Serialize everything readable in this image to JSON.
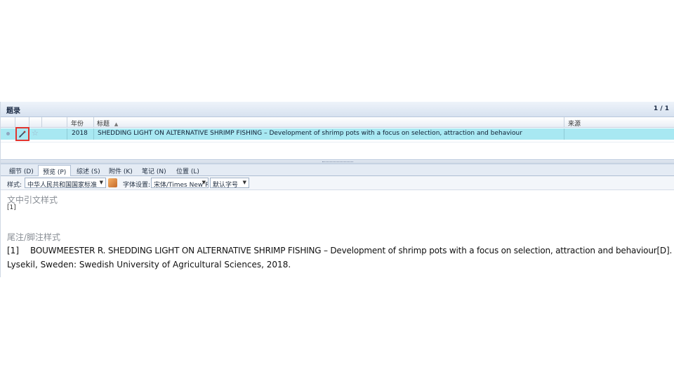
{
  "pane": {
    "title": "题录",
    "pager": "1 / 1"
  },
  "grid": {
    "columns": {
      "year": "年份",
      "title": "标题",
      "sort_indicator": "▲",
      "source": "来源"
    },
    "rows": [
      {
        "year": "2018",
        "title": "SHEDDING LIGHT ON ALTERNATIVE SHRIMP FISHING – Development of shrimp pots with a focus on selection, attraction and behaviour",
        "source": ""
      }
    ]
  },
  "tabs": [
    "细节 (D)",
    "预览 (P)",
    "综述 (S)",
    "附件 (K)",
    "笔记 (N)",
    "位置 (L)"
  ],
  "active_tab_index": 1,
  "toolbar": {
    "style_label": "样式:",
    "style_value": "中华人民共和国国家标准",
    "font_label": "字体设置:",
    "font_value": "宋体/Times New Roman",
    "size_value": "默认字号"
  },
  "preview": {
    "intext_heading": "文中引文样式",
    "intext_citation": "[1]",
    "footnote_heading": "尾注/脚注样式",
    "ref_number": "[1]",
    "ref_line1": "BOUWMEESTER R. SHEDDING LIGHT ON ALTERNATIVE SHRIMP FISHING – Development of shrimp pots with a focus on selection, attraction and behaviour[D].",
    "ref_line2": "Lysekil, Sweden: Swedish University of Agricultural Sciences, 2018."
  },
  "colors": {
    "selected_row": "#a8e8f2",
    "highlight_box": "#e2352f",
    "header_bg": "#d7e2f0"
  },
  "icons": {
    "flag": "dot-icon",
    "attachment": "pen-icon",
    "star": "star-icon",
    "style": "style-manager-icon"
  }
}
